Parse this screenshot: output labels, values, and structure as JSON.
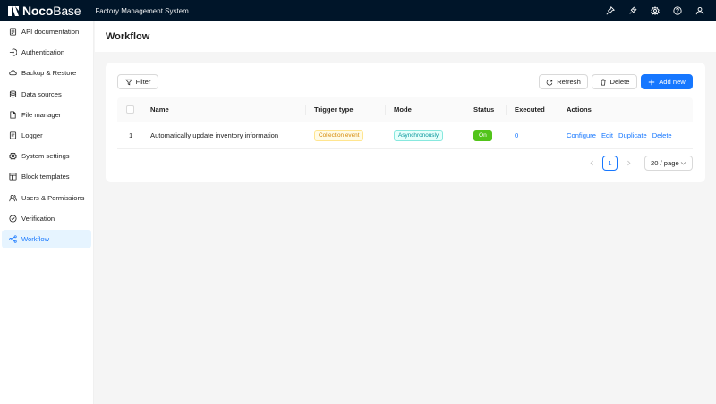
{
  "topbar": {
    "logo_bold": "Noco",
    "logo_light": "Base",
    "app_title": "Factory Management System",
    "icons": [
      "pin-icon",
      "plugin-icon",
      "settings-icon",
      "help-icon",
      "user-icon"
    ]
  },
  "sidebar": {
    "items": [
      {
        "label": "API documentation",
        "icon": "doc-icon"
      },
      {
        "label": "Authentication",
        "icon": "login-icon"
      },
      {
        "label": "Backup & Restore",
        "icon": "cloud-icon"
      },
      {
        "label": "Data sources",
        "icon": "database-icon"
      },
      {
        "label": "File manager",
        "icon": "file-icon"
      },
      {
        "label": "Logger",
        "icon": "logger-icon"
      },
      {
        "label": "System settings",
        "icon": "gear-icon"
      },
      {
        "label": "Block templates",
        "icon": "layout-icon"
      },
      {
        "label": "Users & Permissions",
        "icon": "users-icon"
      },
      {
        "label": "Verification",
        "icon": "check-circle-icon"
      },
      {
        "label": "Workflow",
        "icon": "workflow-icon",
        "active": true
      }
    ]
  },
  "page": {
    "title": "Workflow"
  },
  "toolbar": {
    "filter_label": "Filter",
    "refresh_label": "Refresh",
    "delete_label": "Delete",
    "add_label": "Add new"
  },
  "table": {
    "columns": [
      "Name",
      "Trigger type",
      "Mode",
      "Status",
      "Executed",
      "Actions"
    ],
    "rows": [
      {
        "index": "1",
        "name": "Automatically update inventory information",
        "trigger": "Collection event",
        "mode": "Asynchronously",
        "status": "On",
        "executed": "0",
        "actions": [
          "Configure",
          "Edit",
          "Duplicate",
          "Delete"
        ]
      }
    ]
  },
  "pagination": {
    "current_page": "1",
    "page_size": "20 / page"
  },
  "colors": {
    "topbar": "#001529",
    "primary": "#1677ff",
    "status_on": "#52c41a"
  }
}
